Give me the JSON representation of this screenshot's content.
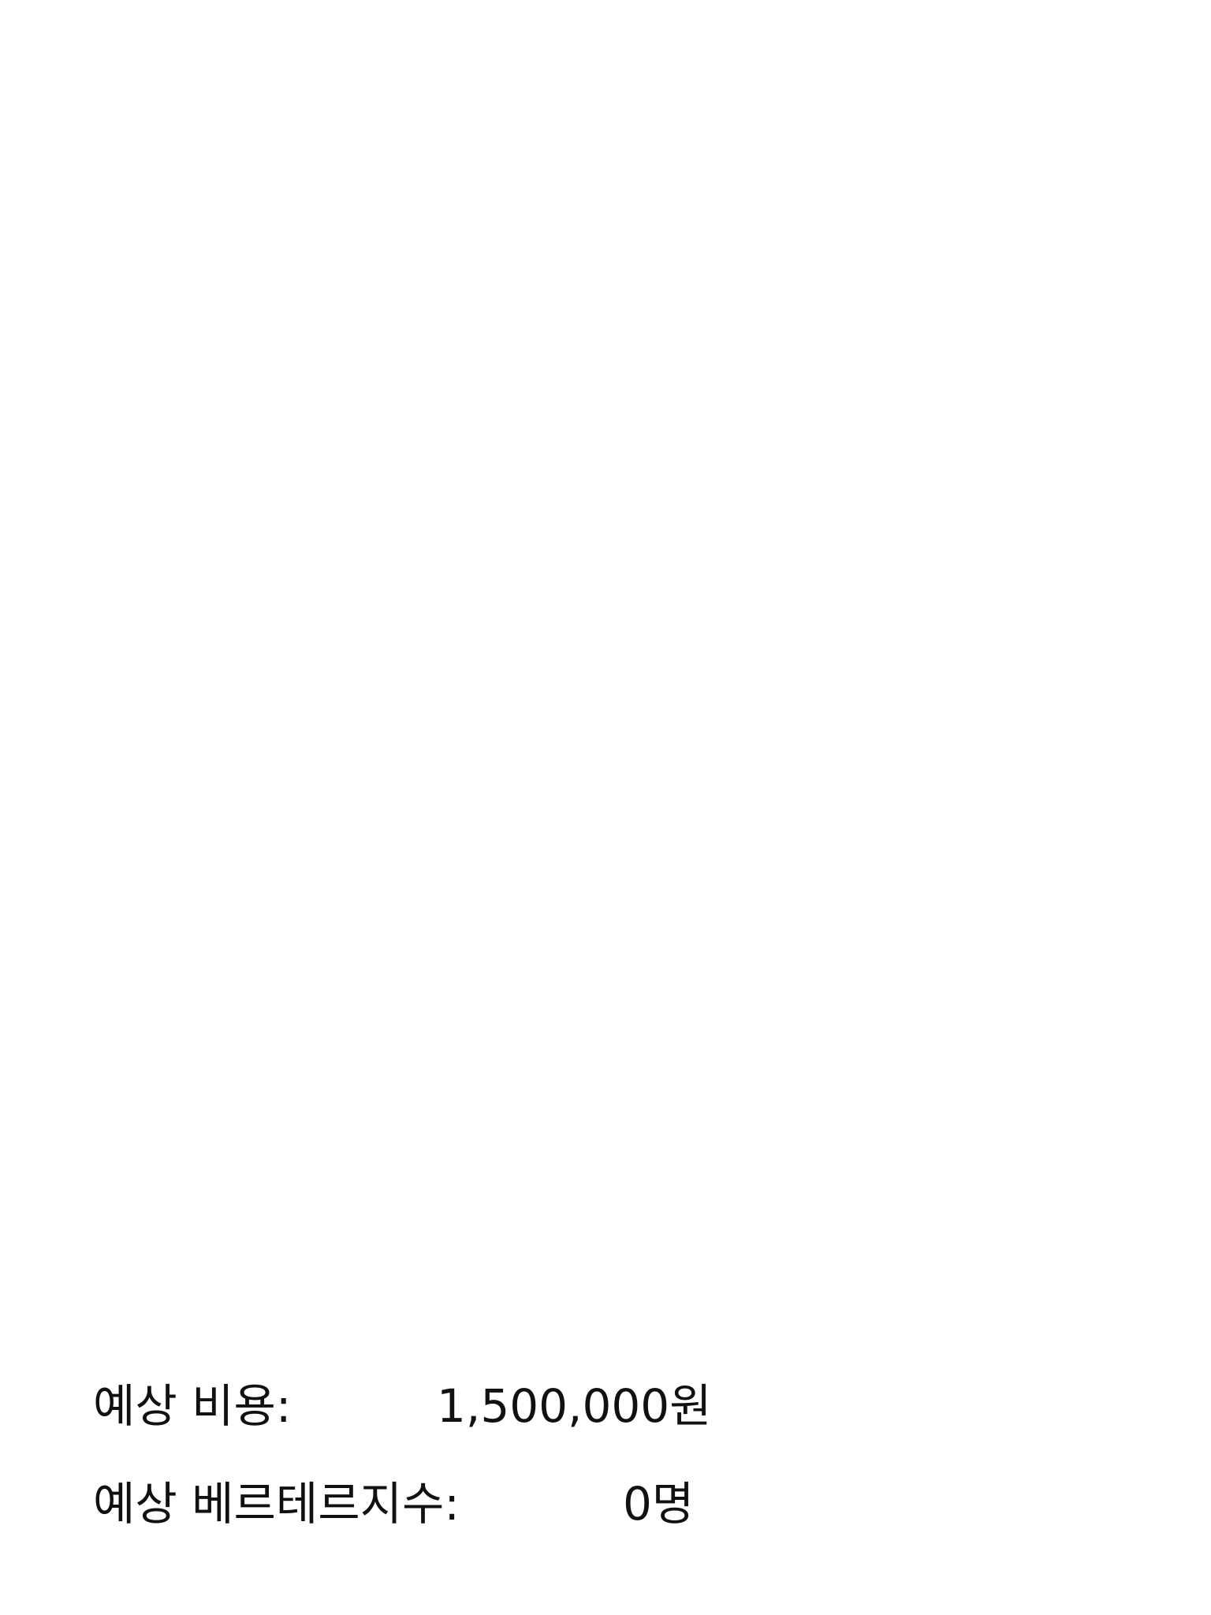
{
  "summary": {
    "cost": {
      "label": "예상 비용:",
      "value": "1,500,000원"
    },
    "count": {
      "label": "예상 베르테르지수:",
      "value": "0명"
    }
  }
}
